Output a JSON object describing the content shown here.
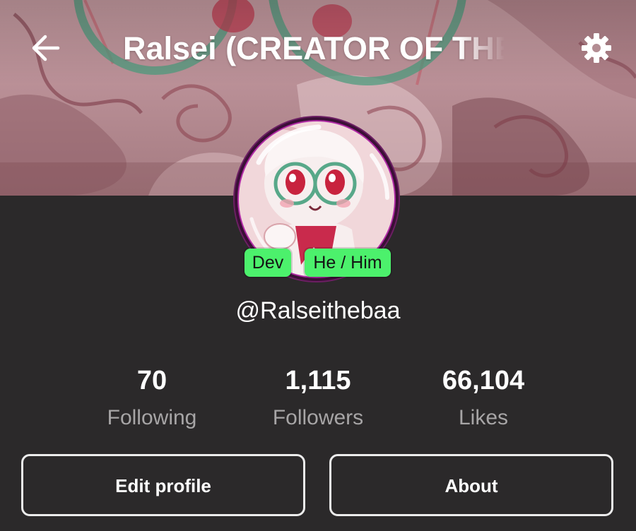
{
  "header": {
    "title": "Ralsei (CREATOR OF THE",
    "back_icon": "arrow-left-icon",
    "settings_icon": "gear-icon"
  },
  "profile": {
    "username": "@Ralseithebaa",
    "badges": [
      {
        "label": "Dev"
      },
      {
        "label": "He / Him"
      }
    ],
    "badge_color": "#4cf16c"
  },
  "stats": [
    {
      "value": "70",
      "label": "Following"
    },
    {
      "value": "1,115",
      "label": "Followers"
    },
    {
      "value": "66,104",
      "label": "Likes"
    }
  ],
  "actions": {
    "edit_label": "Edit profile",
    "about_label": "About"
  },
  "colors": {
    "background": "#2b292a",
    "banner": "#c99ea4",
    "text": "#ffffff",
    "muted": "#a7a5a6"
  }
}
